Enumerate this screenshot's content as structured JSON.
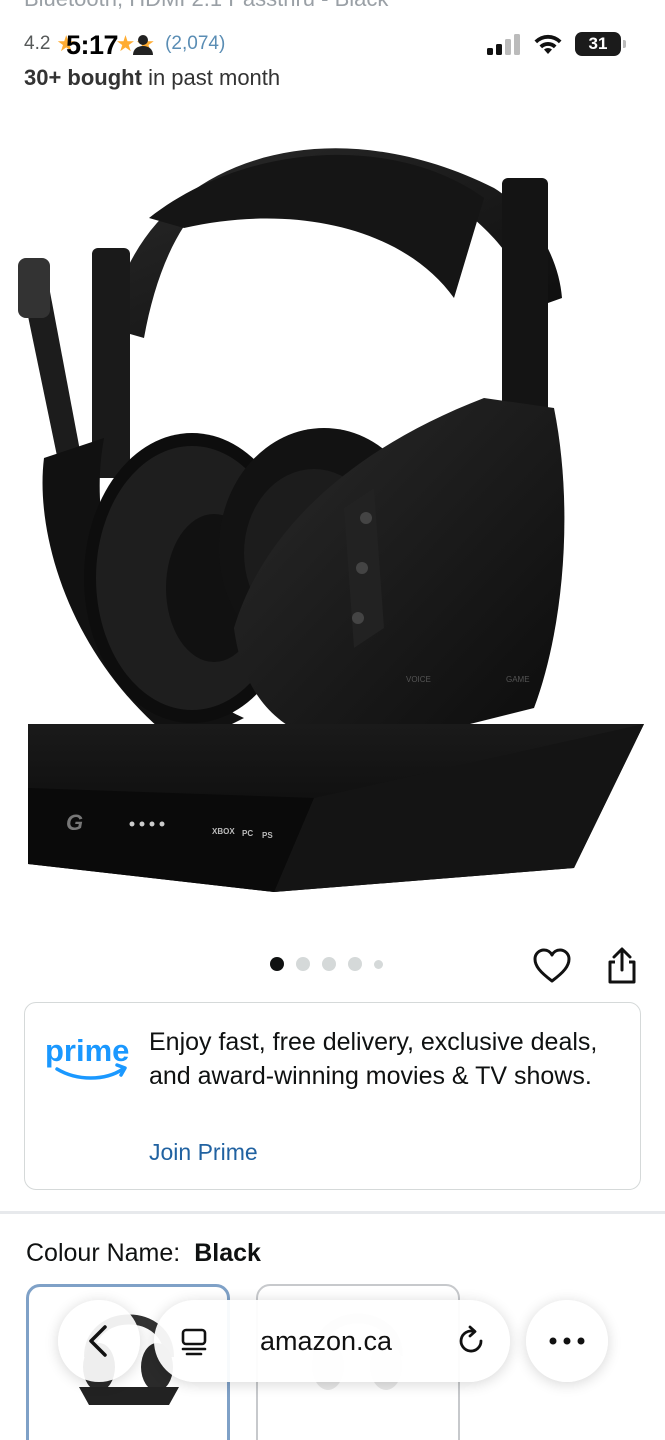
{
  "header": {
    "cut_title": "Bluetooth, HDMI 2.1 Passthru - Black",
    "rating_value": "4.2",
    "rating_count": "(2,074)",
    "bought_count": "30+ bought",
    "bought_suffix": " in past month"
  },
  "status_bar": {
    "time": "5:17",
    "battery_level": "31"
  },
  "gallery": {
    "image_count": 5,
    "active_index": 0,
    "base_brand_mark": "G",
    "base_labels": [
      "XBOX",
      "PC",
      "PS"
    ],
    "cup_labels": [
      "VOICE",
      "GAME"
    ]
  },
  "prime": {
    "logo_text": "prime",
    "message": "Enjoy fast, free delivery, exclusive deals, and award-winning movies & TV shows.",
    "link": "Join Prime"
  },
  "variant": {
    "label": "Colour Name:",
    "value": "Black"
  },
  "browser": {
    "url": "amazon.ca"
  },
  "colors": {
    "star": "#ffa41c",
    "link": "#2162a1",
    "prime_blue": "#1a98ff",
    "selected_border": "#7fa1c7"
  }
}
